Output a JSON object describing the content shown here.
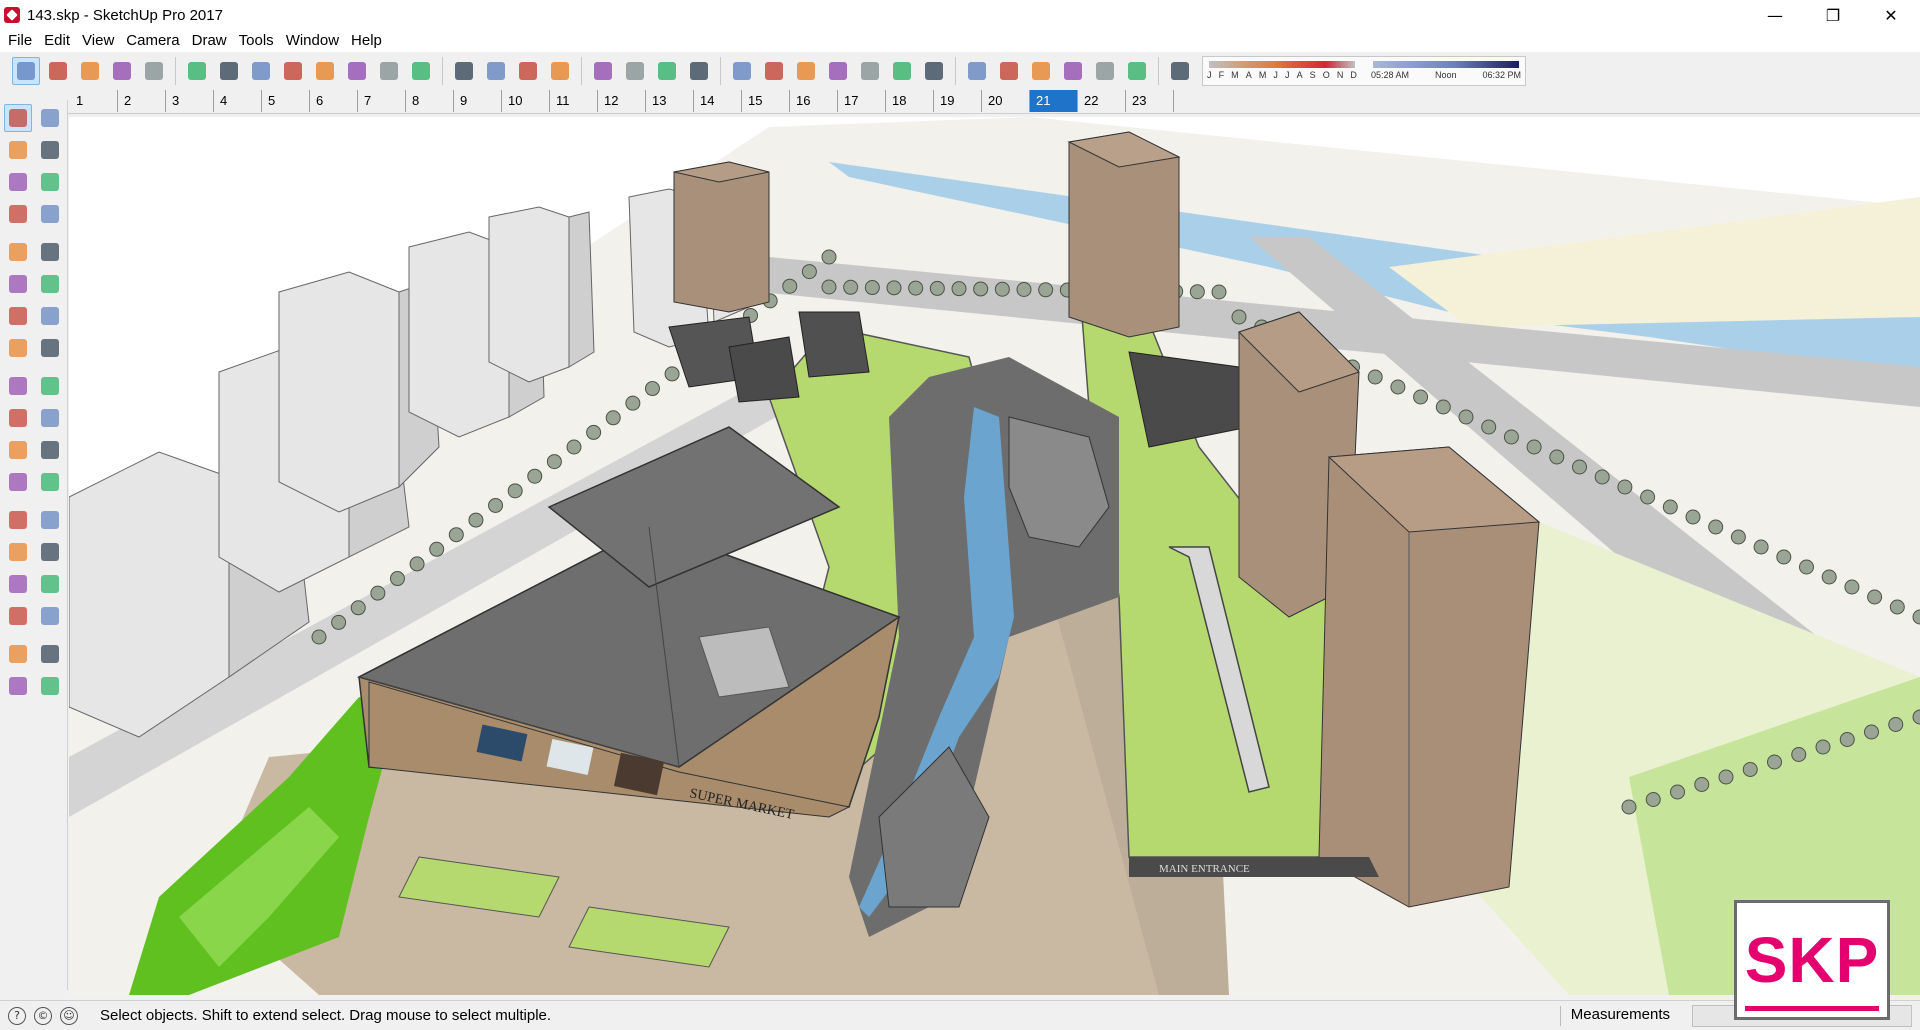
{
  "window": {
    "title": "143.skp - SketchUp Pro 2017",
    "controls": [
      "—",
      "❐",
      "✕"
    ]
  },
  "menu": [
    "File",
    "Edit",
    "View",
    "Camera",
    "Draw",
    "Tools",
    "Window",
    "Help"
  ],
  "toolbar": {
    "icons": [
      "select-icon",
      "eraser-icon",
      "pencil-icon",
      "arc-icon",
      "rectangle-icon",
      "push-pull-icon",
      "follow-me-icon",
      "move-icon",
      "rotate-icon",
      "scale-icon",
      "tape-measure-icon",
      "text-icon",
      "paint-bucket-icon",
      "orbit-icon",
      "pan-icon",
      "zoom-icon",
      "zoom-extents-icon",
      "warehouse-icon",
      "extension-warehouse-icon",
      "send-to-layout-icon",
      "ruby-icon",
      "xray-icon",
      "back-edges-icon",
      "wireframe-icon",
      "hidden-line-icon",
      "shaded-icon",
      "shaded-textures-icon",
      "monochrome-icon",
      "iso-view-icon",
      "top-view-icon",
      "front-view-icon",
      "right-view-icon",
      "back-view-icon",
      "left-view-icon",
      "shadow-toggle-icon"
    ],
    "active_icon": 0,
    "shadows": {
      "months": [
        "J",
        "F",
        "M",
        "A",
        "M",
        "J",
        "J",
        "A",
        "S",
        "O",
        "N",
        "D"
      ],
      "time_start": "05:28 AM",
      "time_mid": "Noon",
      "time_end": "06:32 PM"
    }
  },
  "scenes": {
    "tabs": [
      "1",
      "2",
      "3",
      "4",
      "5",
      "6",
      "7",
      "8",
      "9",
      "10",
      "11",
      "12",
      "13",
      "14",
      "15",
      "16",
      "17",
      "18",
      "19",
      "20",
      "21",
      "22",
      "23"
    ],
    "active": "21"
  },
  "palette": {
    "icons": [
      "select-icon",
      "component-icon",
      "paint-bucket-icon",
      "eraser-icon",
      "line-icon",
      "freehand-icon",
      "rectangle-icon",
      "rotated-rectangle-icon",
      "circle-icon",
      "polygon-icon",
      "arc-icon",
      "two-point-arc-icon",
      "three-point-arc-icon",
      "pie-icon",
      "move-icon",
      "push-pull-icon",
      "rotate-icon",
      "follow-me-icon",
      "scale-icon",
      "offset-icon",
      "tape-measure-icon",
      "dimension-icon",
      "protractor-icon",
      "text-icon",
      "axes-icon",
      "3d-text-icon",
      "orbit-icon",
      "pan-icon",
      "zoom-icon",
      "zoom-window-icon",
      "zoom-extents-icon",
      "previous-icon",
      "position-camera-icon",
      "look-around-icon",
      "walk-icon",
      "section-plane-icon"
    ]
  },
  "viewport": {
    "signage": {
      "supermarket": "SUPER MARKET",
      "main_entrance": "MAIN ENTRANCE"
    }
  },
  "status": {
    "message": "Select objects. Shift to extend select. Drag mouse to select multiple.",
    "measurements_label": "Measurements",
    "measurements_value": ""
  },
  "badge": {
    "text": "SKP"
  },
  "colors": {
    "accent": "#1f74c9",
    "grass": "#b5d96f",
    "bright_grass": "#5fc01f",
    "roof": "#6e6e6e",
    "paving": "#c9b9a2",
    "water": "#9fc8e6",
    "tower": "#a9907a",
    "badge": "#e4006e"
  }
}
